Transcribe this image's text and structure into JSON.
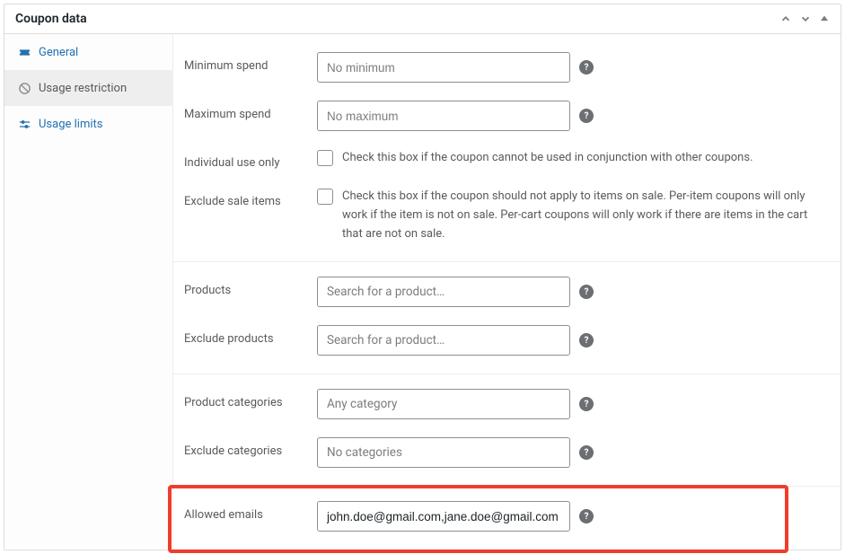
{
  "panel": {
    "title": "Coupon data"
  },
  "sidebar": {
    "items": [
      {
        "label": "General"
      },
      {
        "label": "Usage restriction"
      },
      {
        "label": "Usage limits"
      }
    ]
  },
  "fields": {
    "min_spend": {
      "label": "Minimum spend",
      "placeholder": "No minimum"
    },
    "max_spend": {
      "label": "Maximum spend",
      "placeholder": "No maximum"
    },
    "individual": {
      "label": "Individual use only",
      "desc": "Check this box if the coupon cannot be used in conjunction with other coupons."
    },
    "exclude_sale": {
      "label": "Exclude sale items",
      "desc": "Check this box if the coupon should not apply to items on sale. Per-item coupons will only work if the item is not on sale. Per-cart coupons will only work if there are items in the cart that are not on sale."
    },
    "products": {
      "label": "Products",
      "placeholder": "Search for a product…"
    },
    "exclude_products": {
      "label": "Exclude products",
      "placeholder": "Search for a product…"
    },
    "product_categories": {
      "label": "Product categories",
      "placeholder": "Any category"
    },
    "exclude_categories": {
      "label": "Exclude categories",
      "placeholder": "No categories"
    },
    "allowed_emails": {
      "label": "Allowed emails",
      "value": "john.doe@gmail.com,jane.doe@gmail.com"
    }
  }
}
